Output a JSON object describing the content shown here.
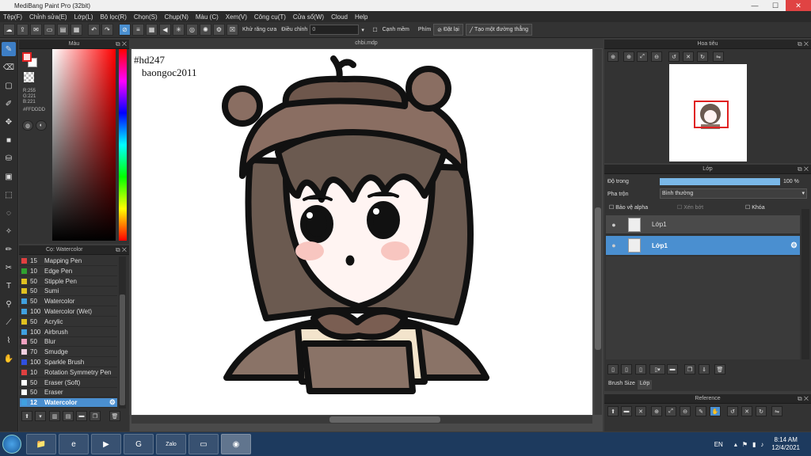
{
  "window": {
    "title": "MediBang Paint Pro (32bit)",
    "minimize": "—",
    "maximize": "☐",
    "close": "✕"
  },
  "menu": [
    "Tệp(F)",
    "Chỉnh sửa(E)",
    "Lớp(L)",
    "Bộ lọc(R)",
    "Chọn(S)",
    "Chụp(N)",
    "Màu (C)",
    "Xem(V)",
    "Công cụ(T)",
    "Cửa sổ(W)",
    "Cloud",
    "Help"
  ],
  "toolbar": {
    "antialias": "Khử răng cưa",
    "correction": "Điều chỉnh",
    "correction_value": "0",
    "smooth": "Cạnh mềm",
    "key": "Phím",
    "reset": "Đặt lại",
    "make_line": "Tạo một đường thẳng"
  },
  "color_panel": {
    "title": "Màu",
    "r": "R:255",
    "g": "G:221",
    "b": "B:221",
    "hex": "#FFDDDD",
    "fg": "#ffdddd",
    "bg": "#ffffff"
  },
  "brush_panel": {
    "title": "Cọ: Watercolor",
    "items": [
      {
        "size": "15",
        "name": "Mapping Pen",
        "color": "#e04040"
      },
      {
        "size": "10",
        "name": "Edge Pen",
        "color": "#30a030"
      },
      {
        "size": "50",
        "name": "Stipple Pen",
        "color": "#e0c020"
      },
      {
        "size": "50",
        "name": "Sumi",
        "color": "#e0c020"
      },
      {
        "size": "50",
        "name": "Watercolor",
        "color": "#40a0e0"
      },
      {
        "size": "100",
        "name": "Watercolor (Wet)",
        "color": "#40a0e0"
      },
      {
        "size": "50",
        "name": "Acrylic",
        "color": "#e0c020"
      },
      {
        "size": "100",
        "name": "Airbrush",
        "color": "#40a0e0"
      },
      {
        "size": "50",
        "name": "Blur",
        "color": "#f0a0c0"
      },
      {
        "size": "70",
        "name": "Smudge",
        "color": "#f0d0e0"
      },
      {
        "size": "100",
        "name": "Sparkle Brush",
        "color": "#3050e0"
      },
      {
        "size": "10",
        "name": "Rotation Symmetry Pen",
        "color": "#e04040"
      },
      {
        "size": "50",
        "name": "Eraser (Soft)",
        "color": "#ffffff"
      },
      {
        "size": "50",
        "name": "Eraser",
        "color": "#ffffff"
      },
      {
        "size": "12",
        "name": "Watercolor",
        "color": "#40a0e0"
      }
    ]
  },
  "document": {
    "tab": "chbi.mdp",
    "text1": "#hd247",
    "text2": "baongoc2011"
  },
  "navigator": {
    "title": "Hoa tiêu"
  },
  "layer_panel": {
    "title": "Lớp",
    "opacity_label": "Độ trong",
    "opacity_value": "100 %",
    "opacity_fraction": 1.0,
    "blend_label": "Pha trộn",
    "blend_value": "Bình thường",
    "protect_alpha": "Bảo vệ alpha",
    "clip": "Xén bớt",
    "lock": "Khóa",
    "layers": [
      {
        "name": "Lớp1",
        "selected": false
      },
      {
        "name": "Lớp1",
        "selected": true
      }
    ],
    "tabs": [
      "Brush Size",
      "Lớp"
    ]
  },
  "reference": {
    "title": "Reference"
  },
  "taskbar": {
    "lang": "EN",
    "time": "8:14 AM",
    "date": "12/4/2021",
    "apps": [
      "📁",
      "e",
      "▶",
      "G",
      "Zalo",
      "▭",
      "◉"
    ]
  }
}
